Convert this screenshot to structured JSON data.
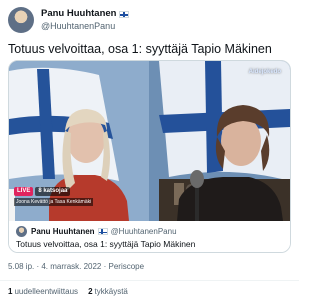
{
  "author": {
    "name": "Panu Huuhtanen",
    "handle": "@HuuhtanenPanu",
    "flag_icon": "finland-flag-icon"
  },
  "tweet": {
    "text": "Totuus velvoittaa, osa 1: syyttäjä Tapio Mäkinen"
  },
  "video": {
    "live_label": "LIVE",
    "viewers": "8 katsojaa",
    "caption": "Joona Kevättö ja Tasa Kenkämäki",
    "broadcast_tag": "Aidejokedo"
  },
  "card": {
    "author_name": "Panu Huuhtanen",
    "author_handle": "@HuuhtanenPanu",
    "title": "Totuus velvoittaa, osa 1: syyttäjä Tapio Mäkinen"
  },
  "meta": {
    "timestamp": "5.08 ip. · 4. marrask. 2022 · Periscope"
  },
  "stats": {
    "retweets_count": "1",
    "retweets_label": "uudelleentwiittaus",
    "likes_count": "2",
    "likes_label": "tykkäystä"
  },
  "colors": {
    "live_badge": "#e0245e",
    "flag_blue": "#1d4fa0",
    "secondary_text": "#536471"
  }
}
